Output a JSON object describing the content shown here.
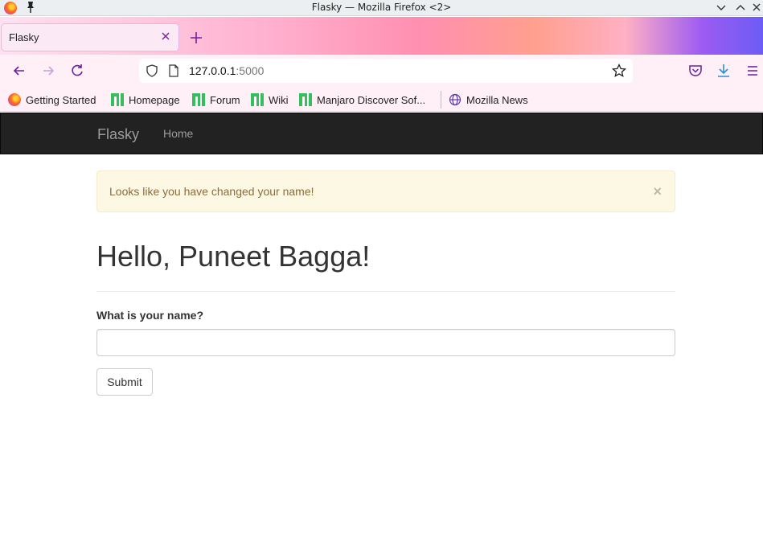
{
  "window": {
    "title": "Flasky — Mozilla Firefox <2>",
    "app_icon": "firefox-icon",
    "pin_icon": "pin-icon",
    "controls": [
      "minimize-icon",
      "maximize-icon",
      "close-icon"
    ]
  },
  "tabs": [
    {
      "label": "Flasky",
      "active": true,
      "close_icon": "close-icon"
    }
  ],
  "new_tab_icon": "plus-icon",
  "toolbar": {
    "back_icon": "arrow-left-icon",
    "forward_icon": "arrow-right-icon",
    "reload_icon": "reload-icon",
    "url": {
      "host": "127.0.0.1",
      "port": ":5000"
    },
    "shield_icon": "shield-icon",
    "page_icon": "page-icon",
    "bookmark_star_icon": "star-icon",
    "pocket_icon": "pocket-icon",
    "downloads_icon": "download-icon",
    "menu_icon": "hamburger-menu-icon"
  },
  "bookmarks": [
    {
      "label": "Getting Started",
      "icon": "firefox-icon"
    },
    {
      "label": "Homepage",
      "icon": "manjaro-icon"
    },
    {
      "label": "Forum",
      "icon": "manjaro-icon"
    },
    {
      "label": "Wiki",
      "icon": "manjaro-icon"
    },
    {
      "label": "Manjaro Discover Sof...",
      "icon": "manjaro-icon"
    },
    {
      "label": "Mozilla News",
      "icon": "globe-icon"
    }
  ],
  "site": {
    "brand": "Flasky",
    "nav_home": "Home",
    "alert": {
      "message": "Looks like you have changed your name!",
      "close": "×"
    },
    "greeting": "Hello, Puneet Bagga!",
    "form": {
      "label": "What is your name?",
      "value": "",
      "submit": "Submit"
    }
  },
  "colors": {
    "navbar_bg": "#222222",
    "alert_bg": "#fcf8e3",
    "alert_text": "#8a6d3b",
    "heading_text": "#333333"
  }
}
